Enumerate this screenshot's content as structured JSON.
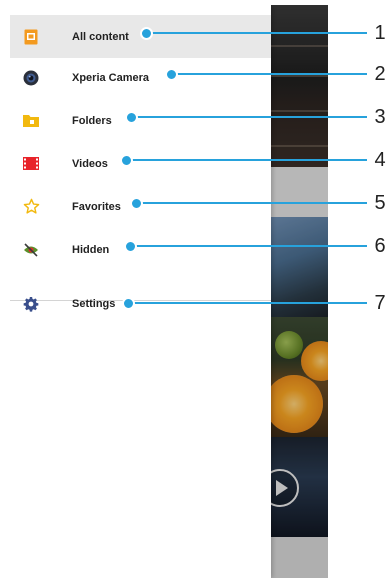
{
  "drawer": {
    "items": [
      {
        "label": "All content",
        "icon": "all-content-icon",
        "active": true
      },
      {
        "label": "Xperia Camera",
        "icon": "camera-icon",
        "active": false
      },
      {
        "label": "Folders",
        "icon": "folder-icon",
        "active": false
      },
      {
        "label": "Videos",
        "icon": "video-icon",
        "active": false
      },
      {
        "label": "Favorites",
        "icon": "star-icon",
        "active": false
      },
      {
        "label": "Hidden",
        "icon": "hidden-eye-icon",
        "active": false
      },
      {
        "label": "Settings",
        "icon": "gear-icon",
        "active": false
      }
    ]
  },
  "callouts": [
    "1",
    "2",
    "3",
    "4",
    "5",
    "6",
    "7"
  ],
  "colors": {
    "accent": "#27a2dc",
    "all_content_icon": "#f39a1f",
    "folder_icon": "#f2b90f",
    "video_icon": "#e8232a",
    "star_icon": "#f2b90f",
    "settings_icon": "#3a4f8c"
  }
}
